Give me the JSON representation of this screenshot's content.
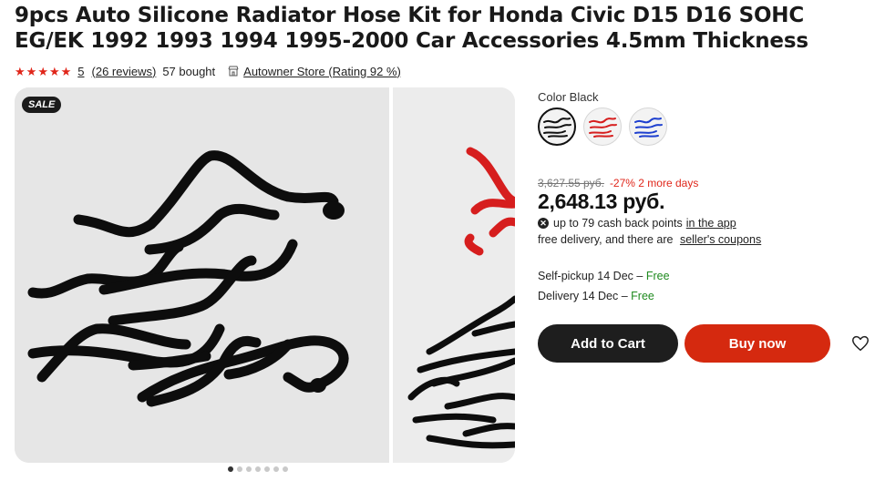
{
  "product": {
    "title": "9pcs Auto Silicone Radiator Hose Kit for Honda Civic D15 D16 SOHC EG/EK 1992 1993 1994 1995-2000 Car Accessories 4.5mm Thickness",
    "rating": "5",
    "stars": 5,
    "reviews": "(26 reviews)",
    "bought": "57 bought",
    "store": "Autowner Store (Rating 92 %)"
  },
  "gallery": {
    "badge": "SALE",
    "dot_count": 7,
    "active_dot": 0
  },
  "options": {
    "color_label": "Color Black",
    "swatches": [
      "black",
      "red",
      "blue"
    ],
    "selected": 0
  },
  "pricing": {
    "old_price": "3,627.55 руб.",
    "discount": "-27% 2 more days",
    "price": "2,648.13 руб.",
    "cashback_text": "up to 79 cash back points",
    "cashback_link": "in the app",
    "delivery_text": "free delivery, and there are",
    "coupons_link": "seller's coupons"
  },
  "shipping": {
    "pickup_text": "Self-pickup 14 Dec –",
    "pickup_free": "Free",
    "delivery_text": "Delivery 14 Dec –",
    "delivery_free": "Free"
  },
  "actions": {
    "cart_label": "Add to Cart",
    "buy_label": "Buy now"
  },
  "colors": {
    "accent_red": "#d5290f",
    "star_red": "#e0261a",
    "free_green": "#1f8a1f",
    "dark": "#1e1e1e"
  },
  "icons": {
    "store": "store-icon",
    "cashback": "cashback-coin-icon",
    "wishlist": "heart-icon"
  }
}
